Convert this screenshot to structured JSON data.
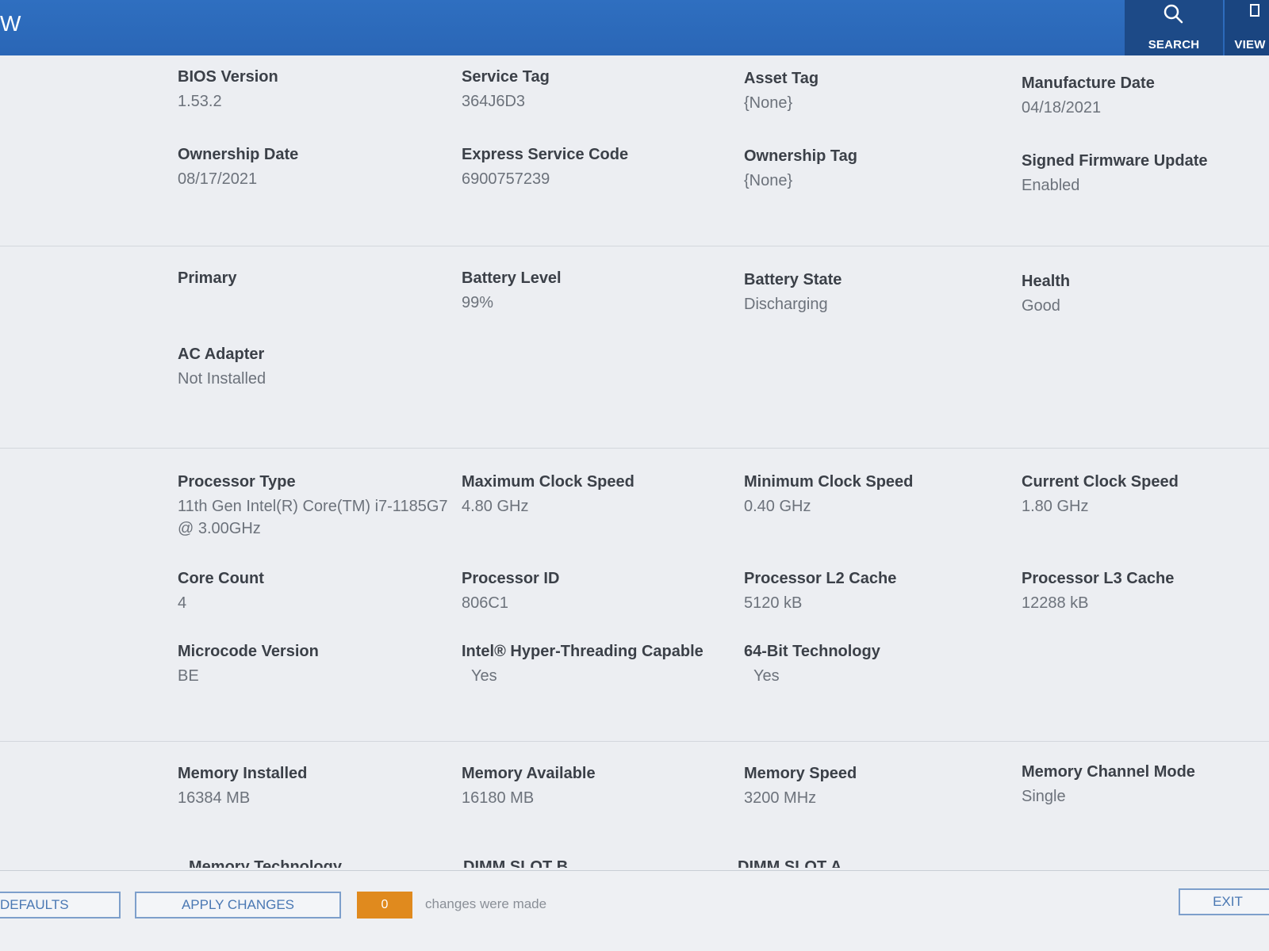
{
  "header": {
    "title": "W",
    "tabs": [
      {
        "label": "SEARCH",
        "icon": "search-icon"
      },
      {
        "label": "VIEW",
        "icon": "view-icon"
      }
    ]
  },
  "system": {
    "bios_version": {
      "label": "BIOS Version",
      "value": "1.53.2"
    },
    "service_tag": {
      "label": "Service Tag",
      "value": "364J6D3"
    },
    "asset_tag": {
      "label": "Asset Tag",
      "value": "{None}"
    },
    "manufacture_date": {
      "label": "Manufacture Date",
      "value": "04/18/2021"
    },
    "ownership_date": {
      "label": "Ownership Date",
      "value": "08/17/2021"
    },
    "express_service_code": {
      "label": "Express Service Code",
      "value": "6900757239"
    },
    "ownership_tag": {
      "label": "Ownership Tag",
      "value": "{None}"
    },
    "signed_firmware_update": {
      "label": "Signed Firmware Update",
      "value": "Enabled"
    }
  },
  "battery": {
    "primary": {
      "label": "Primary"
    },
    "battery_level": {
      "label": "Battery Level",
      "value": "99%"
    },
    "battery_state": {
      "label": "Battery State",
      "value": "Discharging"
    },
    "health": {
      "label": "Health",
      "value": "Good"
    },
    "ac_adapter": {
      "label": "AC Adapter",
      "value": "Not Installed"
    }
  },
  "processor": {
    "processor_type": {
      "label": "Processor Type",
      "value": "11th Gen Intel(R) Core(TM) i7-1185G7 @ 3.00GHz"
    },
    "max_clock": {
      "label": "Maximum Clock Speed",
      "value": "4.80 GHz"
    },
    "min_clock": {
      "label": "Minimum Clock Speed",
      "value": "0.40 GHz"
    },
    "current_clock": {
      "label": "Current Clock Speed",
      "value": "1.80 GHz"
    },
    "core_count": {
      "label": "Core Count",
      "value": "4"
    },
    "processor_id": {
      "label": "Processor ID",
      "value": "806C1"
    },
    "l2_cache": {
      "label": "Processor L2 Cache",
      "value": "5120 kB"
    },
    "l3_cache": {
      "label": "Processor L3 Cache",
      "value": "12288 kB"
    },
    "microcode": {
      "label": "Microcode Version",
      "value": "BE"
    },
    "hyperthreading": {
      "label": "Intel® Hyper-Threading Capable",
      "value": "Yes"
    },
    "bit64": {
      "label": "64-Bit Technology",
      "value": "Yes"
    }
  },
  "memory": {
    "installed": {
      "label": "Memory Installed",
      "value": "16384 MB"
    },
    "available": {
      "label": "Memory Available",
      "value": "16180 MB"
    },
    "speed": {
      "label": "Memory Speed",
      "value": "3200 MHz"
    },
    "channel_mode": {
      "label": "Memory Channel Mode",
      "value": "Single"
    },
    "technology": {
      "label": "Memory Technology"
    },
    "dimm_b": {
      "label": "DIMM SLOT B"
    },
    "dimm_a": {
      "label": "DIMM SLOT A"
    }
  },
  "footer": {
    "defaults_label": "DEFAULTS",
    "apply_label": "APPLY CHANGES",
    "changes_count": "0",
    "changes_text": "changes were made",
    "exit_label": "EXIT"
  },
  "colors": {
    "header": "#2a66b6",
    "accent": "#4a78b3",
    "changes_badge": "#e08a1e"
  }
}
